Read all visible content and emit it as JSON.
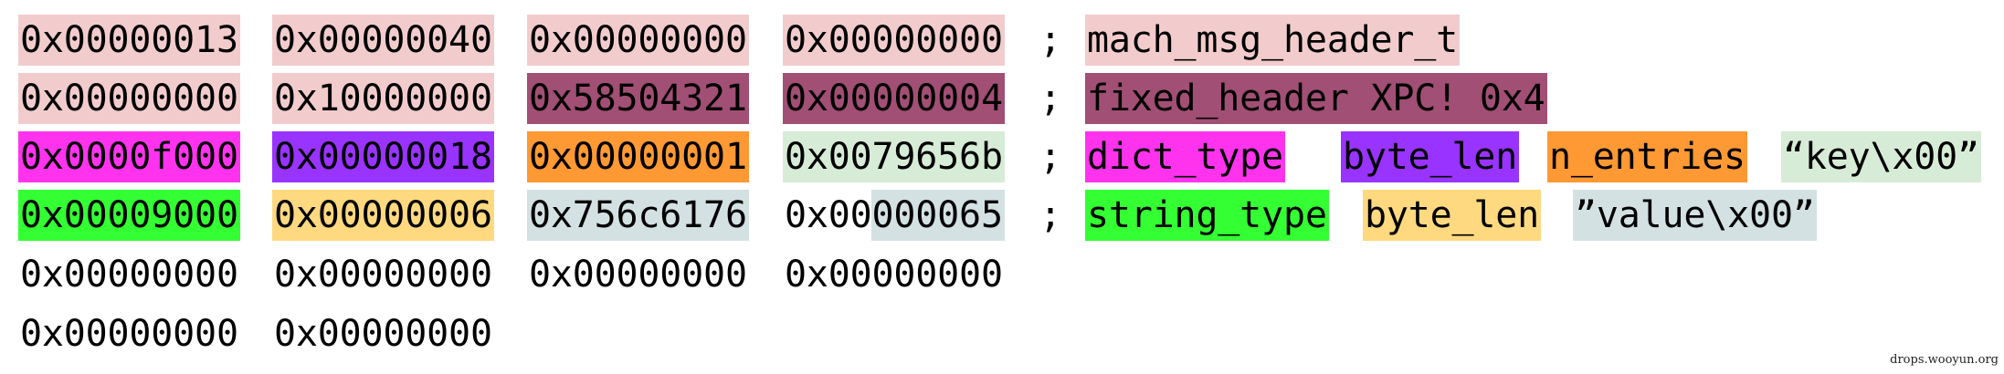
{
  "rows": [
    {
      "words": [
        {
          "text": "0x00000013",
          "bg": "#f2cccc"
        },
        {
          "text": "0x00000040",
          "bg": "#f2cccc"
        },
        {
          "text": "0x00000000",
          "bg": "#f2cccc"
        },
        {
          "text": "0x00000000",
          "bg": "#f2cccc"
        }
      ],
      "separator": ";",
      "labels": [
        {
          "text": "mach_msg_header_t",
          "bg": "#f2cccc"
        }
      ]
    },
    {
      "words": [
        {
          "text": "0x00000000",
          "bg": "#f2cccc"
        },
        {
          "text": "0x10000000",
          "bg": "#f2cccc"
        },
        {
          "text": "0x58504321",
          "bg": "#a14f74"
        },
        {
          "text": "0x00000004",
          "bg": "#a14f74"
        }
      ],
      "separator": ";",
      "labels": [
        {
          "text": "fixed_header XPC! 0x4",
          "bg": "#a14f74"
        }
      ]
    },
    {
      "words": [
        {
          "text": "0x0000f000",
          "bg": "#ff33ee"
        },
        {
          "text": "0x00000018",
          "bg": "#9933ff"
        },
        {
          "text": "0x00000001",
          "bg": "#ff9933"
        },
        {
          "text": "0x0079656b",
          "bg": "#d7ecd7"
        }
      ],
      "separator": ";",
      "labels": [
        {
          "text": "dict_type",
          "bg": "#ff33ee"
        },
        {
          "text": "byte_len",
          "bg": "#9933ff"
        },
        {
          "text": "n_entries",
          "bg": "#ff9933"
        },
        {
          "text": "“key\\x00”",
          "bg": "#d7ecd7"
        }
      ]
    },
    {
      "words": [
        {
          "text": "0x00009000",
          "bg": "#33ff33"
        },
        {
          "text": "0x00000006",
          "bg": "#ffd980"
        },
        {
          "text": "0x756c6176",
          "bg": "#d3e1e3"
        },
        {
          "text": "0x00000065",
          "bg": "#d3e1e3",
          "partial": true
        }
      ],
      "separator": ";",
      "labels": [
        {
          "text": "string_type",
          "bg": "#33ff33"
        },
        {
          "text": "byte_len",
          "bg": "#ffd980"
        },
        {
          "text": "”value\\x00”",
          "bg": "#d3e1e3"
        }
      ]
    },
    {
      "words": [
        {
          "text": "0x00000000",
          "bg": ""
        },
        {
          "text": "0x00000000",
          "bg": ""
        },
        {
          "text": "0x00000000",
          "bg": ""
        },
        {
          "text": "0x00000000",
          "bg": ""
        }
      ],
      "separator": "",
      "labels": []
    },
    {
      "words": [
        {
          "text": "0x00000000",
          "bg": ""
        },
        {
          "text": "0x00000000",
          "bg": ""
        }
      ],
      "separator": "",
      "labels": []
    }
  ],
  "watermark": "drops.wooyun.org"
}
